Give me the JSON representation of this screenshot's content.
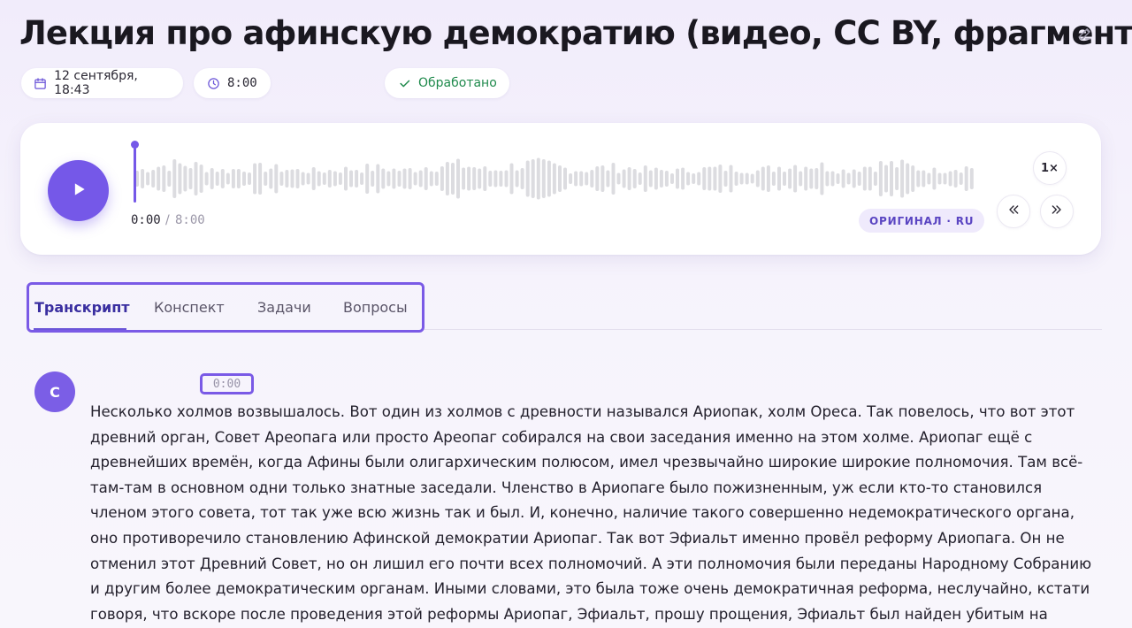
{
  "header": {
    "title": "Лекция про афинскую демократию (видео, CC BY, фрагмент)",
    "edit_icon": "pencil-icon"
  },
  "meta": {
    "date": "12 сентября, 18:43",
    "duration": "8:00",
    "status": "Обработано",
    "date_icon": "calendar-icon",
    "duration_icon": "clock-icon",
    "status_icon": "check-icon"
  },
  "player": {
    "current_time": "0:00",
    "separator": "/",
    "total_time": "8:00",
    "progress": 0.0,
    "language": "ОРИГИНАЛ · RU",
    "speed": "1×",
    "play_icon": "play-icon",
    "rewind_icon": "rewind-icon",
    "forward_icon": "fast-forward-icon",
    "accent_color": "#7558e8",
    "bar_color": "#dcdce0"
  },
  "tabs": [
    {
      "label": "Транскрипт",
      "active": true
    },
    {
      "label": "Конспект",
      "active": false
    },
    {
      "label": "Задачи",
      "active": false
    },
    {
      "label": "Вопросы",
      "active": false
    }
  ],
  "transcript": {
    "speaker_initial": "С",
    "timestamp": "0:00",
    "text": "Несколько холмов возвышалось. Вот один из холмов с древности назывался Ариопак, холм Ореса. Так повелось, что вот этот древний орган, Совет Ареопага или просто Ареопаг собирался на свои заседания именно на этом холме. Ариопаг ещё с древнейших времён, когда Афины были олигархическим полюсом, имел чрезвычайно широкие широкие полномочия. Там всё-там-там в основном одни только знатные заседали. Членство в Ариопаге было пожизненным, уж если кто-то становился членом этого совета, тот так уже всю жизнь так и был. И, конечно, наличие такого совершенно недемократического органа, оно противоречило становлению Афинской демократии Ариопаг. Так вот Эфиальт именно провёл реформу Ариопага. Он не отменил этот Древний Совет, но он лишил его почти всех полномочий. А эти полномочия были переданы Народному Собранию и другим более демократическим органам. Иными словами, это была тоже очень демократичная реформа, неслучайно, кстати говоря, что вскоре после проведения этой реформы Ариопаг, Эфиальт, прошу прощения, Эфиальт был найден убитым на одной из афинских улиц."
  }
}
